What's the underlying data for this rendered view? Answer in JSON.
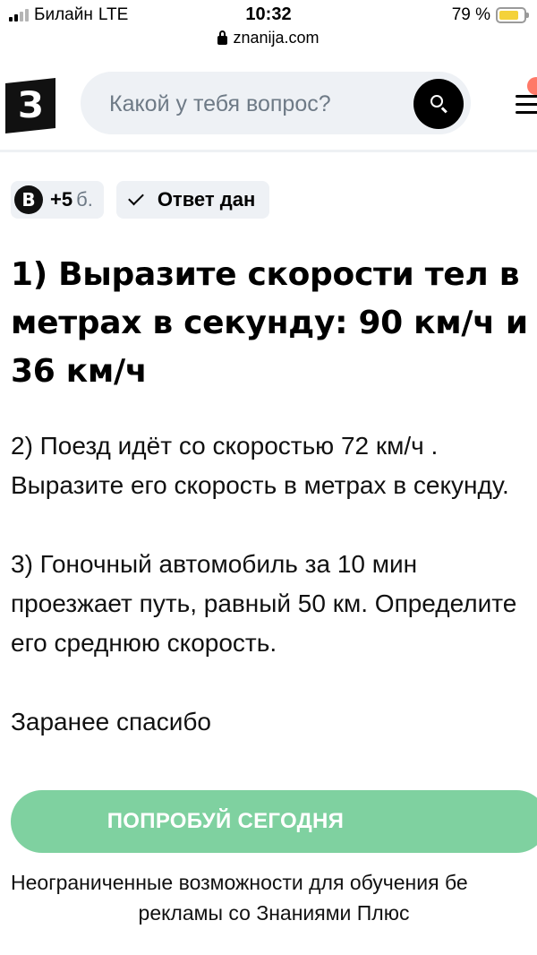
{
  "status_bar": {
    "carrier": "Билайн",
    "network": "LTE",
    "time": "10:32",
    "battery": "79 %",
    "battery_level": 0.79,
    "battery_color": "#f4d23a"
  },
  "url": "znanija.com",
  "header": {
    "logo_letter": "З",
    "search_placeholder": "Какой у тебя вопрос?",
    "search_icon": "search-icon",
    "menu_icon": "hamburger-menu-icon",
    "notification_dot_color": "#ff7968"
  },
  "tags": {
    "points_icon_letter": "B",
    "points_value": "+5",
    "points_unit": "б.",
    "answered_label": "Ответ дан"
  },
  "question": {
    "title": "1) Выразите скорости тел в метрах в секунду: 90 км/ч и 36 км/ч",
    "paragraphs": [
      "2) Поезд идёт со скоростью 72 км/ч . Выразите его скорость в метрах в секунду.",
      "3) Гоночный автомобиль за 10 мин проезжает путь, равный 50 км. Определите его среднюю скорость.",
      "Заранее спасибо"
    ]
  },
  "promo": {
    "button_label": "ПОПРОБУЙ СЕГОДНЯ",
    "button_color": "#7fd1a0",
    "text_line1": "Неограниченные возможности для обучения бе",
    "text_line2": "рекламы со Знаниями Плюс"
  }
}
